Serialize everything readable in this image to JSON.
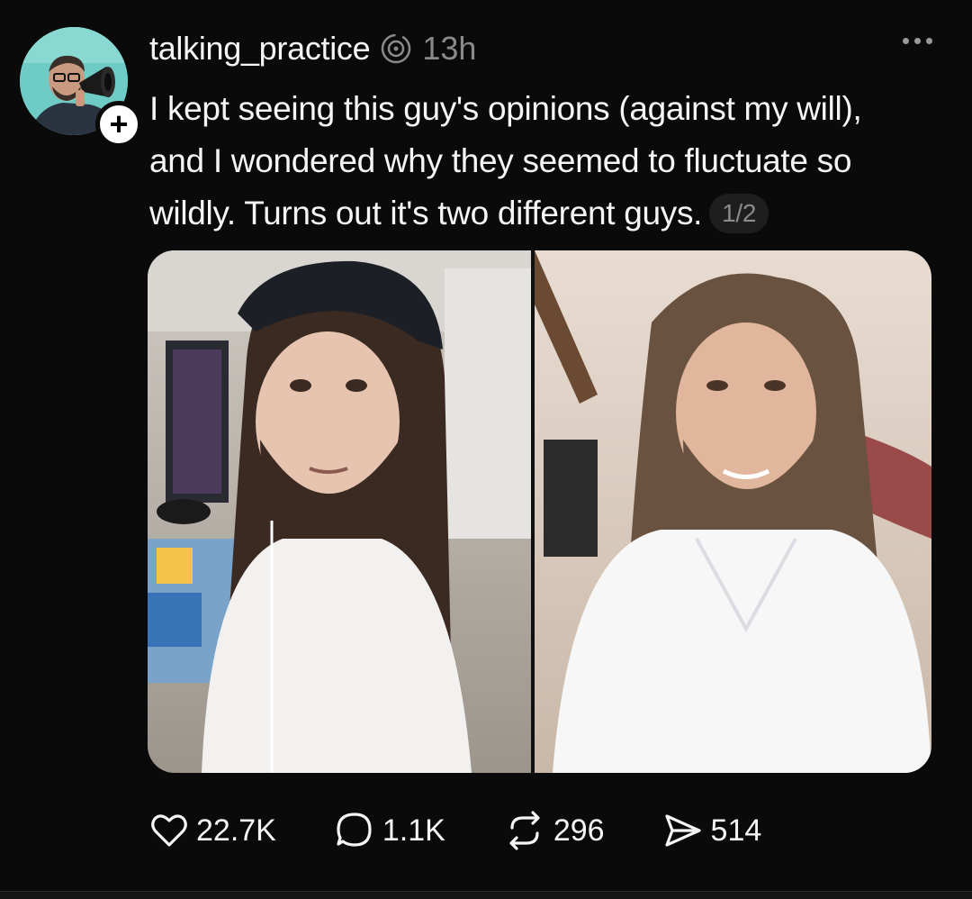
{
  "post": {
    "author": {
      "username": "talking_practice",
      "avatar_icon": "avatar-person-megaphone",
      "follow_label": "+"
    },
    "verified_icon": "threads-icon",
    "timestamp": "13h",
    "more_icon": "more-horizontal-icon",
    "text_lines": [
      "I kept seeing this guy's opinions (against my will),",
      "and I wondered why they seemed to fluctuate so",
      "wildly. Turns out it's two different guys."
    ],
    "page_badge": "1/2",
    "media": {
      "left_image": "photo-man-long-hair-backwards-cap",
      "right_image": "photo-man-long-hair-white-shirt"
    },
    "actions": {
      "likes": "22.7K",
      "replies": "1.1K",
      "reposts": "296",
      "shares": "514"
    }
  },
  "colors": {
    "background": "#0a0a0a",
    "text": "#f3f5f7",
    "secondary_text": "#8a8a8a"
  }
}
